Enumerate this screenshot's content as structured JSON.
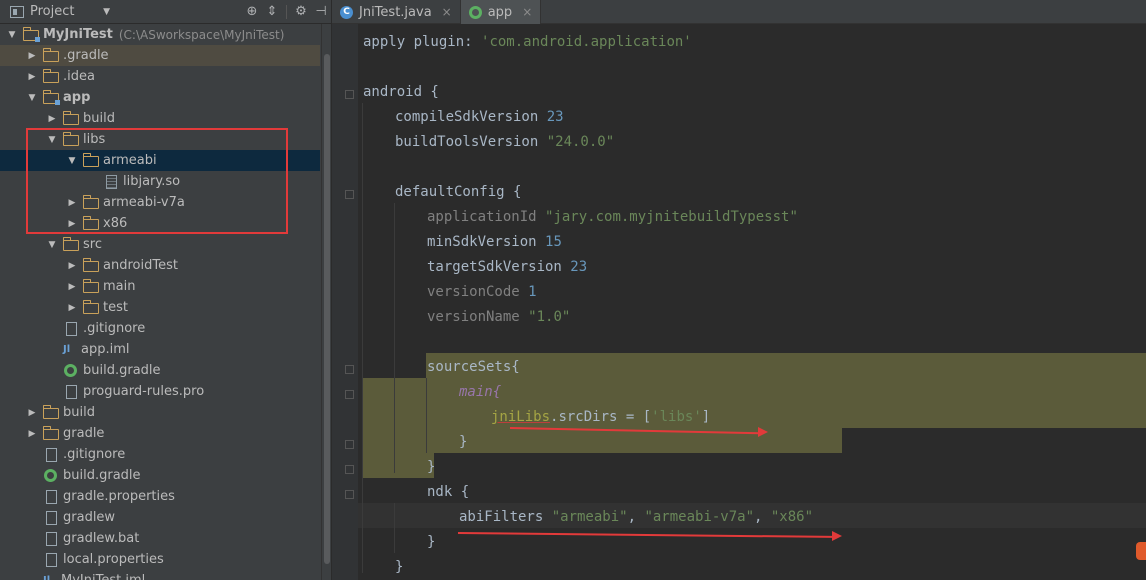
{
  "project_panel": {
    "selector_label": "Project",
    "tree": [
      {
        "label": "MyJniTest",
        "path": "(C:\\ASworkspace\\MyJniTest)",
        "icon": "module-folder",
        "expanded": true,
        "depth": 0,
        "bold": true
      },
      {
        "label": ".gradle",
        "icon": "folder",
        "expanded": false,
        "depth": 1,
        "highlight": true
      },
      {
        "label": ".idea",
        "icon": "folder",
        "expanded": false,
        "depth": 1
      },
      {
        "label": "app",
        "icon": "module-folder",
        "expanded": true,
        "depth": 1,
        "bold": true
      },
      {
        "label": "build",
        "icon": "folder",
        "expanded": false,
        "depth": 2
      },
      {
        "label": "libs",
        "icon": "folder",
        "expanded": true,
        "depth": 2
      },
      {
        "label": "armeabi",
        "icon": "folder",
        "expanded": true,
        "depth": 3,
        "selected": true
      },
      {
        "label": "libjary.so",
        "icon": "so-file",
        "depth": 4
      },
      {
        "label": "armeabi-v7a",
        "icon": "folder",
        "expanded": false,
        "depth": 3
      },
      {
        "label": "x86",
        "icon": "folder",
        "expanded": false,
        "depth": 3
      },
      {
        "label": "src",
        "icon": "folder",
        "expanded": true,
        "depth": 2
      },
      {
        "label": "androidTest",
        "icon": "folder",
        "expanded": false,
        "depth": 3
      },
      {
        "label": "main",
        "icon": "folder",
        "expanded": false,
        "depth": 3
      },
      {
        "label": "test",
        "icon": "folder",
        "expanded": false,
        "depth": 3
      },
      {
        "label": ".gitignore",
        "icon": "file",
        "depth": 2
      },
      {
        "label": "app.iml",
        "icon": "iml-file",
        "depth": 2
      },
      {
        "label": "build.gradle",
        "icon": "gradle-file",
        "depth": 2
      },
      {
        "label": "proguard-rules.pro",
        "icon": "file",
        "depth": 2
      },
      {
        "label": "build",
        "icon": "folder",
        "expanded": false,
        "depth": 1
      },
      {
        "label": "gradle",
        "icon": "folder",
        "expanded": false,
        "depth": 1
      },
      {
        "label": ".gitignore",
        "icon": "file",
        "depth": 1
      },
      {
        "label": "build.gradle",
        "icon": "gradle-file",
        "depth": 1
      },
      {
        "label": "gradle.properties",
        "icon": "file",
        "depth": 1
      },
      {
        "label": "gradlew",
        "icon": "file",
        "depth": 1
      },
      {
        "label": "gradlew.bat",
        "icon": "file",
        "depth": 1
      },
      {
        "label": "local.properties",
        "icon": "file",
        "depth": 1
      },
      {
        "label": "MyJniTest.iml",
        "icon": "iml-file",
        "depth": 1
      }
    ]
  },
  "editor": {
    "tabs": [
      {
        "label": "JniTest.java",
        "icon": "java-class-icon",
        "active": false
      },
      {
        "label": "app",
        "icon": "gradle-icon",
        "active": true
      }
    ],
    "code": {
      "l1_a": "apply plugin: ",
      "l1_b": "'com.android.application'",
      "l3": "android {",
      "l4_a": "compileSdkVersion ",
      "l4_b": "23",
      "l5_a": "buildToolsVersion ",
      "l5_b": "\"24.0.0\"",
      "l7": "defaultConfig {",
      "l8_a": "applicationId ",
      "l8_b": "\"jary.com.myjnitebuildTypesst\"",
      "l9_a": "minSdkVersion ",
      "l9_b": "15",
      "l10_a": "targetSdkVersion ",
      "l10_b": "23",
      "l11_a": "versionCode ",
      "l11_b": "1",
      "l12_a": "versionName ",
      "l12_b": "\"1.0\"",
      "l14": "sourceSets{",
      "l15": "main{",
      "l16_a": "jniLibs",
      "l16_b": ".srcDirs = [",
      "l16_c": "'libs'",
      "l16_d": "]",
      "l17": "}",
      "l18": "}",
      "l19": "ndk {",
      "l20_a": "abiFilters ",
      "l20_b": "\"armeabi\"",
      "l20_c": ", ",
      "l20_d": "\"armeabi-v7a\"",
      "l20_e": ", ",
      "l20_f": "\"x86\"",
      "l21": "}",
      "l22": "}"
    }
  }
}
